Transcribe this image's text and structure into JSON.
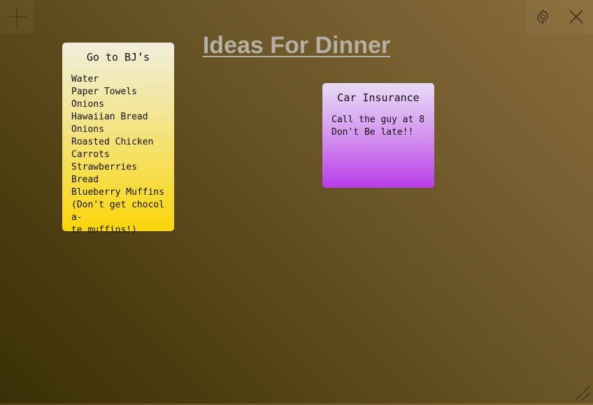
{
  "toolbar": {
    "add_icon": "plus-icon",
    "settings_icon": "gear-icon",
    "close_icon": "close-icon"
  },
  "page": {
    "title": "Ideas For Dinner"
  },
  "notes": [
    {
      "title": "Go to BJ’s",
      "body": "Water\nPaper Towels\nOnions\nHawaiian Bread\nOnions\nRoasted Chicken\nCarrots\nStrawberries\nBread\nBlueberry Muffins\n(Don't get chocola-\nte muffins!)",
      "color": "#fbd60a"
    },
    {
      "title": "Car Insurance",
      "body": "Call the guy at 8\nDon't Be late!!",
      "color": "#b83ce8"
    }
  ],
  "colors": {
    "background_light": "#8a6c3a",
    "background_dark": "#3a2f05",
    "title": "#b5b0a4"
  }
}
